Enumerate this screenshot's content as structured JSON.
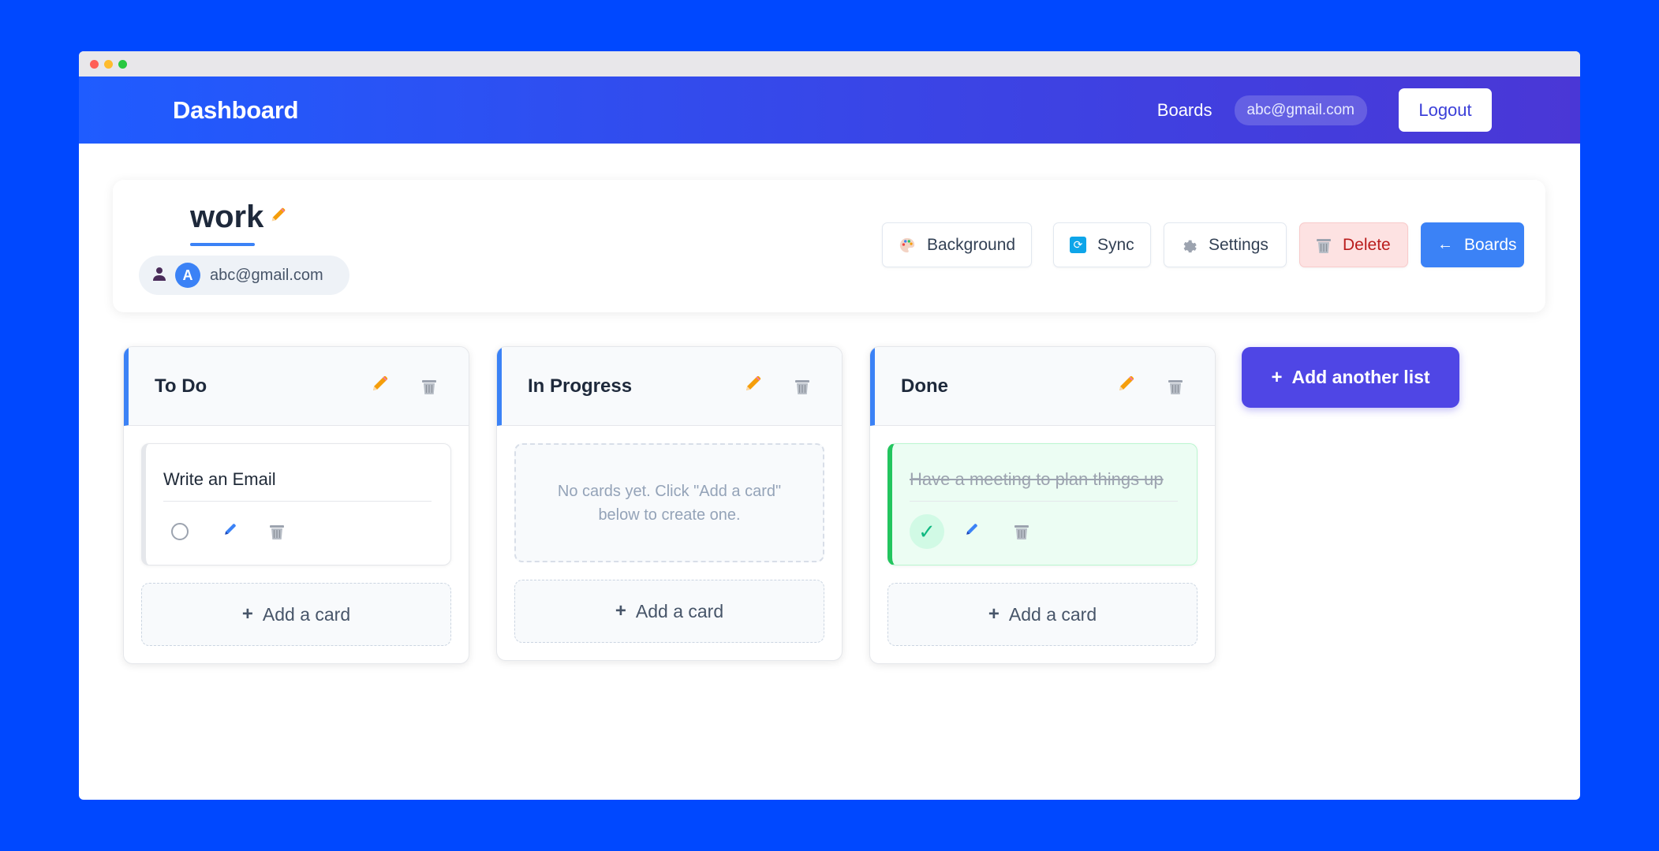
{
  "navbar": {
    "brand": "Dashboard",
    "boards_link": "Boards",
    "user_email": "abc@gmail.com",
    "logout_label": "Logout"
  },
  "board": {
    "title": "work",
    "owner_initial": "A",
    "owner_email": "abc@gmail.com",
    "actions": {
      "background": "Background",
      "sync": "Sync",
      "settings": "Settings",
      "delete": "Delete",
      "boards": "Boards"
    }
  },
  "lists": [
    {
      "title": "To Do",
      "cards": [
        {
          "text": "Write an Email",
          "completed": false
        }
      ],
      "add_card_label": "Add a card"
    },
    {
      "title": "In Progress",
      "cards": [],
      "empty_message": "No cards yet. Click \"Add a card\" below to create one.",
      "add_card_label": "Add a card"
    },
    {
      "title": "Done",
      "cards": [
        {
          "text": "Have a meeting to plan things up",
          "completed": true
        }
      ],
      "add_card_label": "Add a card"
    }
  ],
  "add_list_label": "Add another list",
  "icons": {
    "plus": "+",
    "arrow_left": "←",
    "pencil": "✏",
    "check": "✓"
  },
  "colors": {
    "page_background": "#0048ff",
    "accent_blue": "#3b82f6",
    "add_list": "#4f46e5",
    "delete_red": "#b91c1c",
    "done_green": "#22c55e"
  }
}
